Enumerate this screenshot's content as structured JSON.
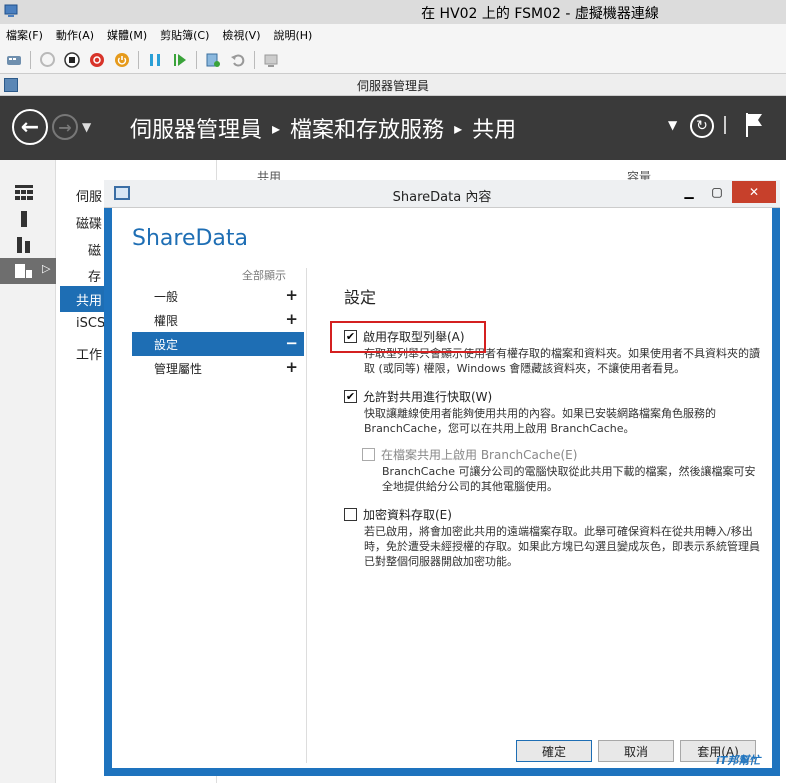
{
  "window": {
    "title": "在 HV02 上的 FSM02 - 虛擬機器連線"
  },
  "menubar": {
    "items": [
      "檔案(F)",
      "動作(A)",
      "媒體(M)",
      "剪貼簿(C)",
      "檢視(V)",
      "說明(H)"
    ]
  },
  "toolbar": {
    "icons": [
      "ctrl-alt-del-icon",
      "start-icon",
      "turn-off-icon",
      "shutdown-icon",
      "power-icon",
      "pause-icon",
      "resume-icon",
      "checkpoint-icon",
      "revert-icon",
      "enhanced-session-icon"
    ]
  },
  "app": {
    "title": "伺服器管理員"
  },
  "header": {
    "breadcrumb": [
      "伺服器管理員",
      "檔案和存放服務",
      "共用"
    ]
  },
  "nav": {
    "items": [
      "伺服",
      "磁碟",
      "磁",
      "存",
      "共用",
      "iSCS",
      "工作"
    ]
  },
  "background": {
    "col1": "共用",
    "col2": "容量"
  },
  "dialog": {
    "title": "ShareData 內容",
    "heading": "ShareData",
    "show_all": "全部顯示",
    "nav": [
      {
        "label": "一般",
        "symbol": "+"
      },
      {
        "label": "權限",
        "symbol": "+"
      },
      {
        "label": "設定",
        "symbol": "−"
      },
      {
        "label": "管理屬性",
        "symbol": "+"
      }
    ],
    "settings": {
      "title": "設定",
      "options": [
        {
          "label": "啟用存取型列舉(A)",
          "checked": true,
          "enabled": true,
          "desc": "存取型列舉只會顯示使用者有權存取的檔案和資料夾。如果使用者不具資料夾的讀取 (或同等) 權限，Windows 會隱藏該資料夾，不讓使用者看見。"
        },
        {
          "label": "允許對共用進行快取(W)",
          "checked": true,
          "enabled": true,
          "desc": "快取讓離線使用者能夠使用共用的內容。如果已安裝網路檔案角色服務的 BranchCache，您可以在共用上啟用 BranchCache。"
        },
        {
          "label": "在檔案共用上啟用 BranchCache(E)",
          "checked": false,
          "enabled": false,
          "desc": "BranchCache 可讓分公司的電腦快取從此共用下載的檔案，然後讓檔案可安全地提供給分公司的其他電腦使用。"
        },
        {
          "label": "加密資料存取(E)",
          "checked": false,
          "enabled": true,
          "desc": "若已啟用，將會加密此共用的遠端檔案存取。此舉可確保資料在從共用轉入/移出時，免於遭受未經授權的存取。如果此方塊已勾選且變成灰色，即表示系統管理員已對整個伺服器開啟加密功能。"
        }
      ]
    },
    "buttons": {
      "ok": "確定",
      "cancel": "取消",
      "apply": "套用(A)"
    }
  },
  "watermark": "iT邦幫忙"
}
